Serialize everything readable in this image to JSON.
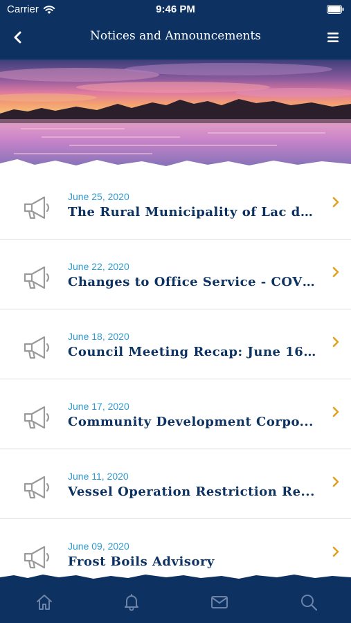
{
  "status_bar": {
    "carrier": "Carrier",
    "time": "9:46 PM"
  },
  "nav": {
    "title": "Notices and Announcements",
    "back_icon": "chevron-left-icon",
    "menu_icon": "hamburger-menu-icon"
  },
  "hero": {
    "image": "sunset-lake-photo"
  },
  "notices": [
    {
      "date": "June 25, 2020",
      "title": "The Rural Municipality of Lac du..."
    },
    {
      "date": "June 22, 2020",
      "title": "Changes to Office Service - COVI..."
    },
    {
      "date": "June 18, 2020",
      "title": "Council Meeting Recap: June 16, ..."
    },
    {
      "date": "June 17, 2020",
      "title": "Community Development Corpo..."
    },
    {
      "date": "June 11, 2020",
      "title": "Vessel Operation Restriction Re..."
    },
    {
      "date": "June 09, 2020",
      "title": "Frost Boils Advisory"
    }
  ],
  "tab_bar": {
    "tabs": [
      {
        "icon": "home-icon"
      },
      {
        "icon": "bell-icon"
      },
      {
        "icon": "mail-icon"
      },
      {
        "icon": "search-icon"
      }
    ]
  },
  "colors": {
    "brand_navy": "#0d3262",
    "date_blue": "#2f9bd0",
    "chevron_gold": "#e0a020"
  }
}
